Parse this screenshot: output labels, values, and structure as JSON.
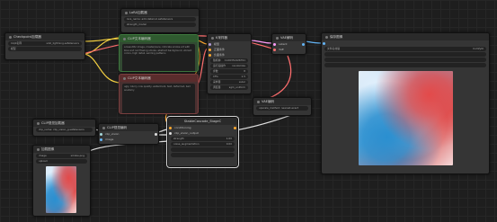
{
  "nodes": {
    "checkpoint": {
      "title": "Checkpoint加载器",
      "w1_label": "Ckpt名称",
      "w1_value": "sdxl_lightning.safetensors",
      "w2": "模型"
    },
    "lora": {
      "title": "LoRA加载器",
      "w1": "lora_name: add-detail-xl.safetensors",
      "w2": "strength_model",
      "w3": "strength_clip"
    },
    "pos_prompt": {
      "title": "CLIP文本编码器",
      "text": "a beautiful image, masterpiece, intricate smoke art with blue and red flowing smoke, abstract background, vibrant colors, high detail, swirling patterns"
    },
    "neg_prompt": {
      "title": "CLIP文本编码器",
      "text": "ugly, blurry, low quality, watermark, text, deformed, bad anatomy"
    },
    "ksampler": {
      "title": "K采样器",
      "inputs": [
        "模型",
        "正面条件",
        "负面条件",
        "Latent"
      ],
      "widgets": [
        {
          "k": "随机种",
          "v": "1126351426791"
        },
        {
          "k": "运行后操作",
          "v": "randomize"
        },
        {
          "k": "步数",
          "v": "8"
        },
        {
          "k": "CFG",
          "v": "1.5"
        },
        {
          "k": "采样器",
          "v": "euler"
        },
        {
          "k": "调度器",
          "v": "sgm_uniform"
        },
        {
          "k": "降噪",
          "v": "1.00"
        }
      ]
    },
    "vae_decode": {
      "title": "VAE解码",
      "in1": "Latent",
      "in2": "VAE",
      "out": "图像"
    },
    "save_image": {
      "title": "保存图像",
      "w1_label": "文件名前缀",
      "w1_value": "ComfyUI",
      "rows": [
        "",
        "",
        "",
        ""
      ]
    },
    "upscale": {
      "title": "VAE编码",
      "w1": "upscale_method: nearest-exact"
    },
    "clip_vision_loader": {
      "title": "CLIP视觉加载器",
      "w1": "clip_name: clip_vision_g.safetensors"
    },
    "clip_vision_encode": {
      "title": "CLIP视觉编码",
      "in1": "clip_vision",
      "in2": "image",
      "out": "CLIP视觉输出"
    },
    "load_image": {
      "title": "加载图像",
      "w1_label": "image",
      "w1_value": "smoke.png",
      "w2": "upload"
    },
    "unclip": {
      "title": "StableCascade_StageC",
      "inputs": [
        "conditioning",
        "clip_vision_output",
        "",
        "",
        ""
      ],
      "widgets": [
        {
          "k": "strength",
          "v": "1.00"
        },
        {
          "k": "noise_augmentation",
          "v": "0.00"
        },
        {
          "k": "",
          "v": ""
        },
        {
          "k": "",
          "v": ""
        },
        {
          "k": "",
          "v": ""
        }
      ],
      "outputs": [
        "conditioning",
        "",
        ""
      ]
    }
  },
  "colors": {
    "model": "#b39ddb",
    "clip": "#f5d142",
    "conditioning": "#ffa931",
    "latent": "#ff9cf9",
    "vae": "#ff6e6e",
    "image": "#64b5f6",
    "clip_vision": "#a8dadc"
  }
}
